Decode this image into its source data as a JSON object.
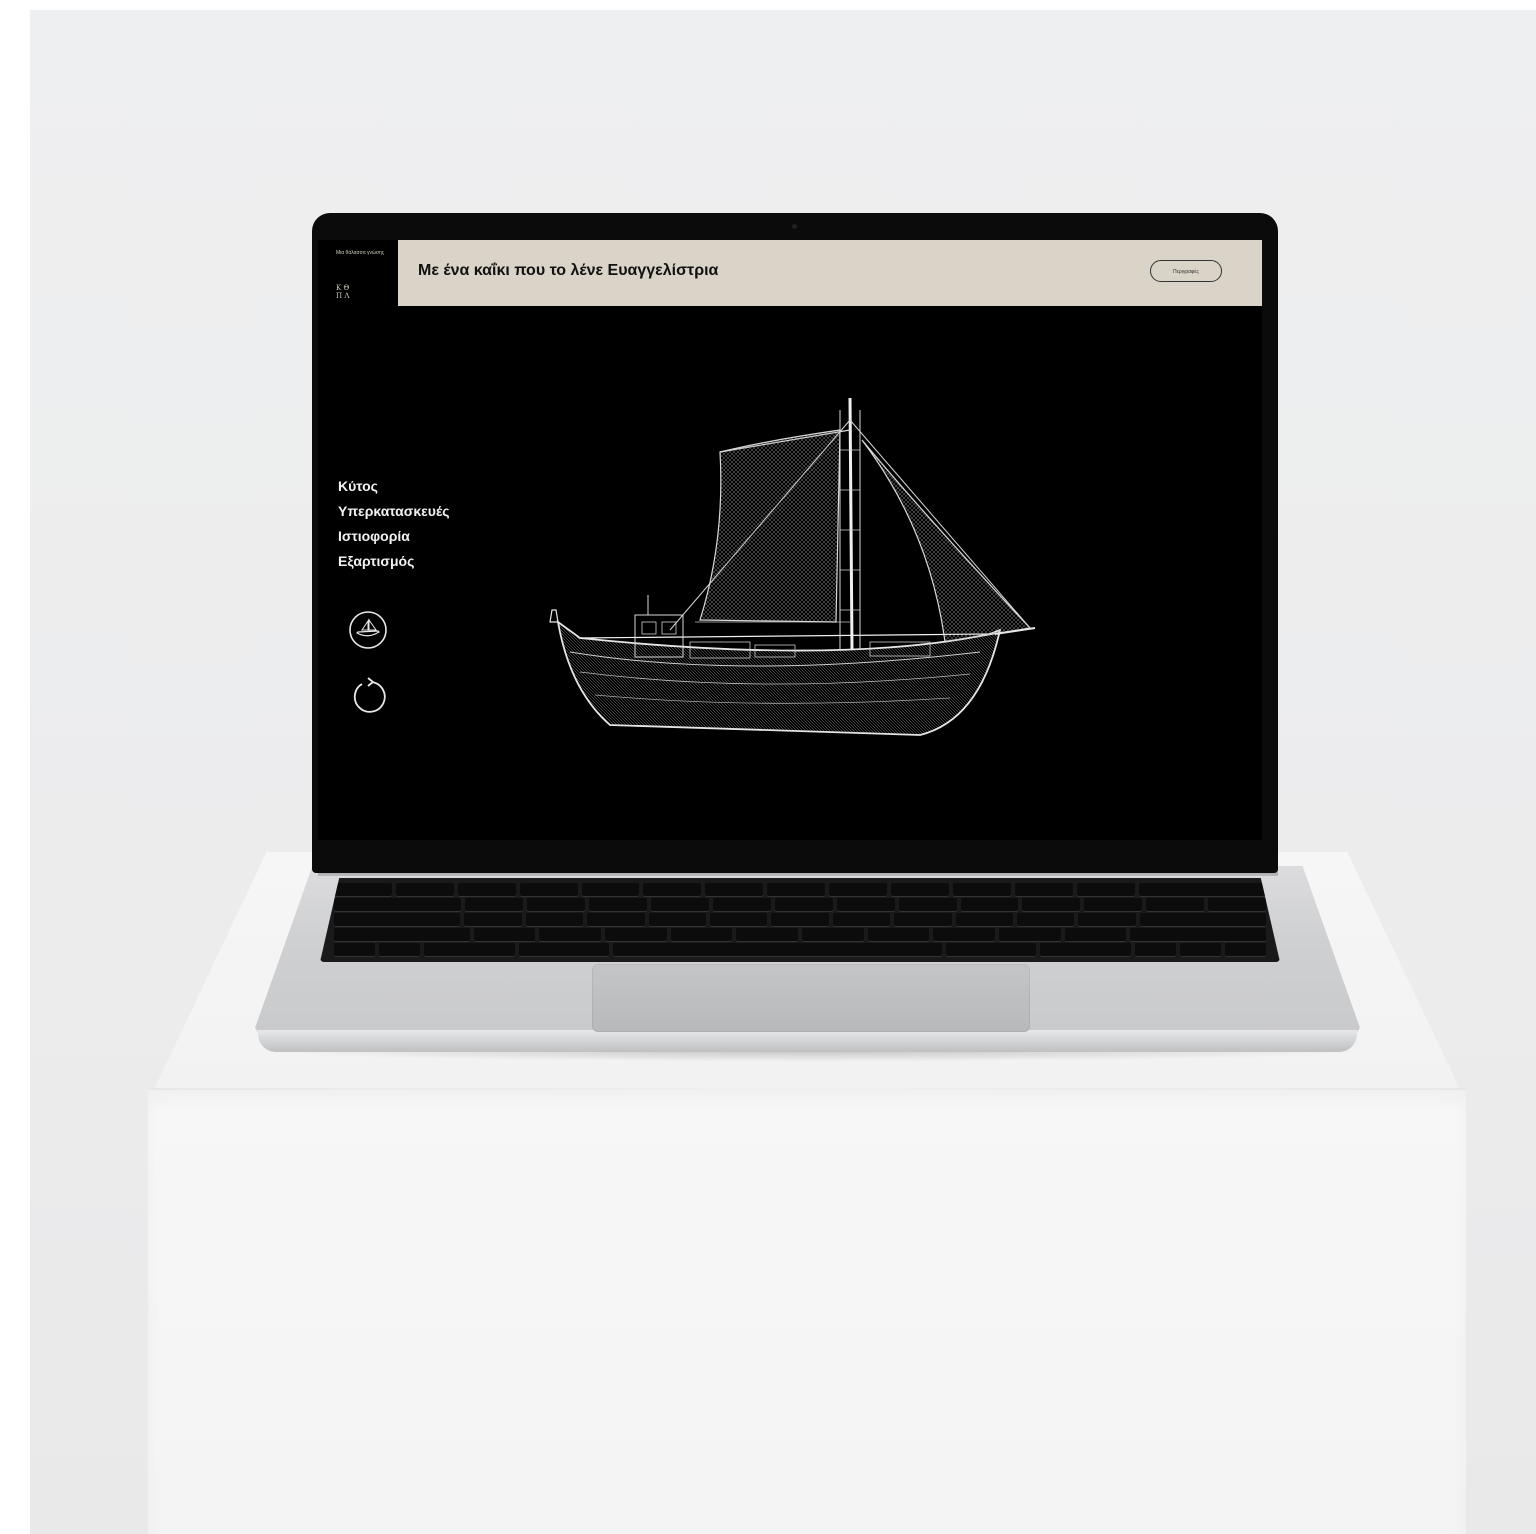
{
  "header": {
    "logo_text": "Μια θάλασσα γνώσης",
    "logo_mark": "Κ Θ\nΠ Λ",
    "title": "Με ένα καΐκι που το λένε Ευαγγελίστρια",
    "button_label": "Περιγραφές"
  },
  "side_menu": {
    "items": [
      {
        "label": "Κύτος"
      },
      {
        "label": "Υπερκατασκευές"
      },
      {
        "label": "Ιστιοφορία"
      },
      {
        "label": "Εξαρτισμός"
      }
    ],
    "ship_view_icon": "ship-icon",
    "reset_icon": "rotate-icon"
  },
  "colors": {
    "header_background": "#d9d4c7",
    "screen_background": "#000000",
    "menu_text": "#f2f2f2"
  }
}
